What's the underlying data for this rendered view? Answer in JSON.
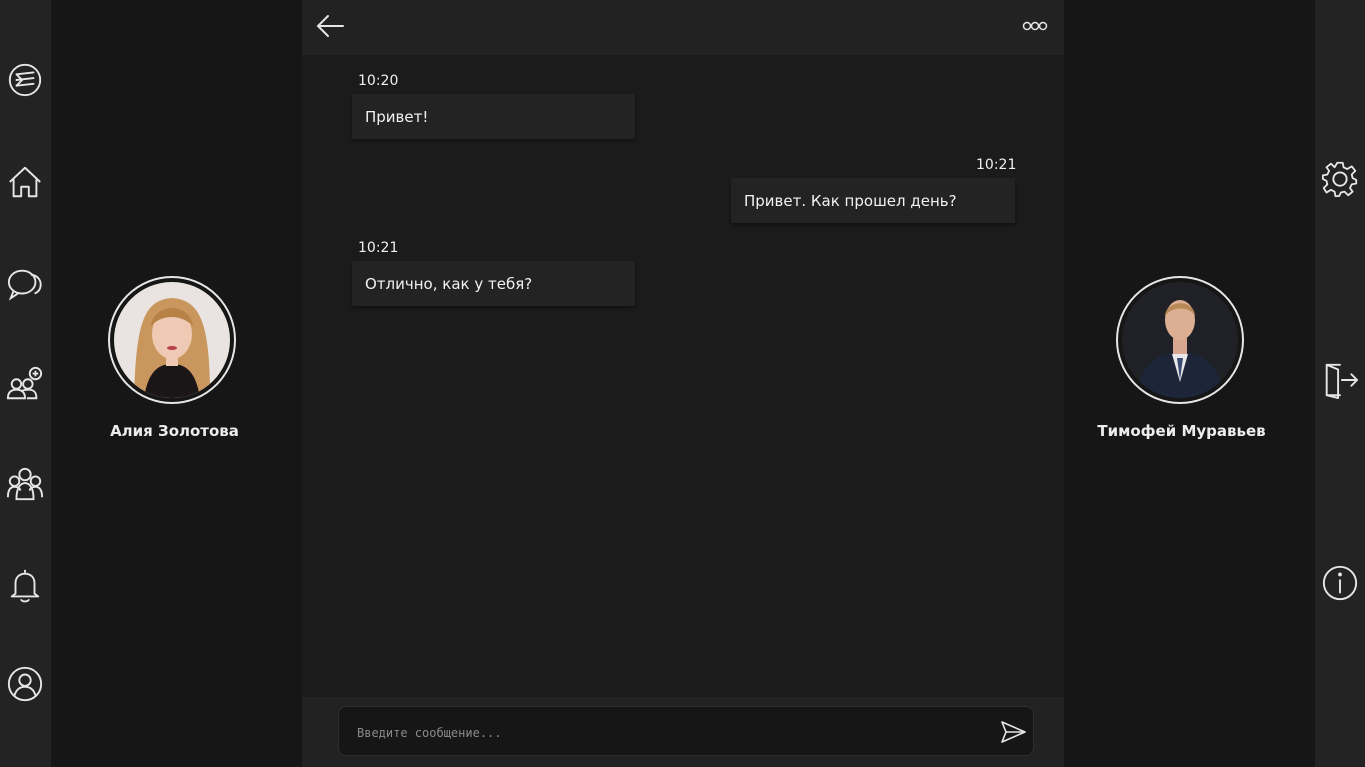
{
  "left_nav": {
    "items": [
      {
        "icon": "logo-icon"
      },
      {
        "icon": "home-icon"
      },
      {
        "icon": "chats-icon"
      },
      {
        "icon": "add-friend-icon"
      },
      {
        "icon": "groups-icon"
      },
      {
        "icon": "bell-icon"
      },
      {
        "icon": "profile-icon"
      }
    ]
  },
  "right_nav": {
    "items": [
      {
        "icon": "gear-icon"
      },
      {
        "icon": "logout-icon"
      },
      {
        "icon": "info-icon"
      }
    ]
  },
  "participants": {
    "left": {
      "name": "Алия Золотова"
    },
    "right": {
      "name": "Тимофей Муравьев"
    }
  },
  "chat": {
    "header": {
      "back_icon": "arrow-left-icon",
      "menu_icon": "more-dots-icon"
    },
    "messages": [
      {
        "time": "10:20",
        "text": "Привет!",
        "side": "incoming"
      },
      {
        "time": "10:21",
        "text": "Привет. Как прошел день?",
        "side": "outgoing"
      },
      {
        "time": "10:21",
        "text": "Отлично, как у тебя?",
        "side": "incoming"
      }
    ],
    "composer": {
      "placeholder": "Введите сообщение...",
      "value": "",
      "send_icon": "send-icon"
    }
  },
  "colors": {
    "rail_bg": "#232323",
    "page_bg": "#161616",
    "chat_bg": "#1b1b1b",
    "bubble_bg": "#232323",
    "text": "#f2f2f2"
  }
}
